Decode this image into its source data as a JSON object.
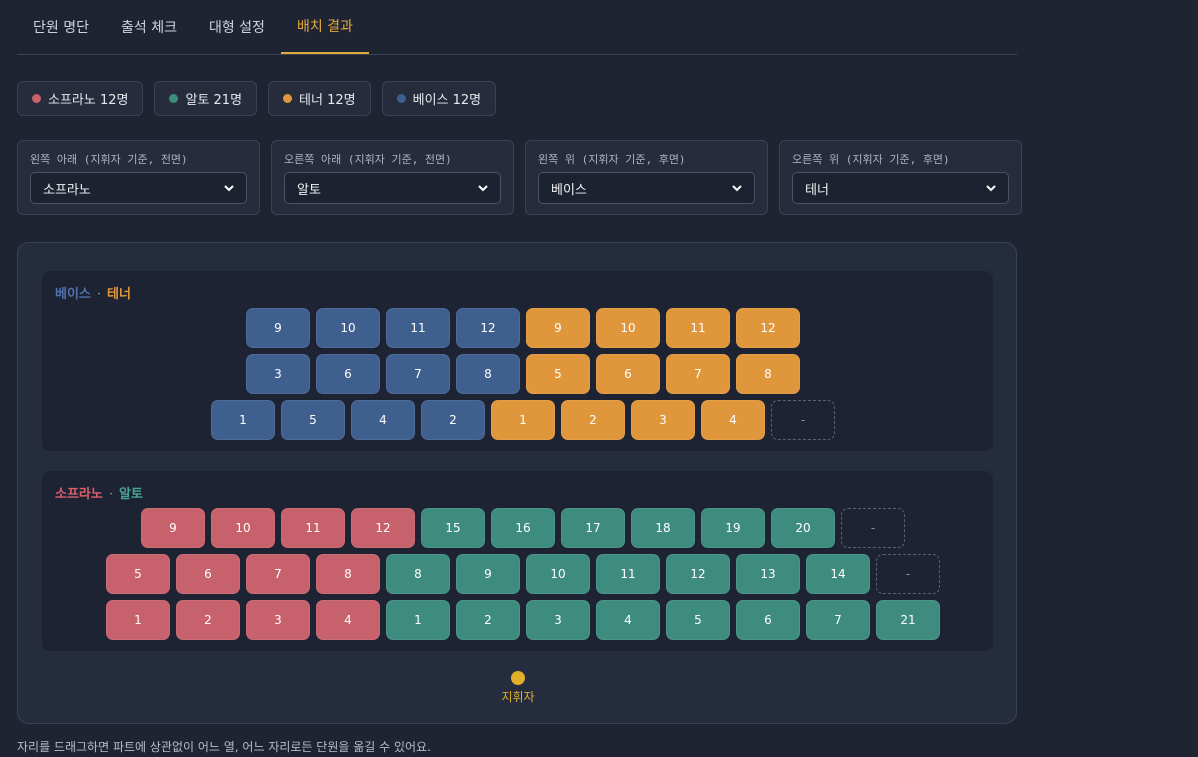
{
  "tabs": [
    {
      "label": "단원 명단"
    },
    {
      "label": "출석 체크"
    },
    {
      "label": "대형 설정"
    },
    {
      "label": "배치 결과"
    }
  ],
  "active_tab": 3,
  "parts": [
    {
      "label": "소프라노 12명",
      "color": "#c7616b"
    },
    {
      "label": "알토 21명",
      "color": "#3e8c7e"
    },
    {
      "label": "테너 12명",
      "color": "#e0963b"
    },
    {
      "label": "베이스 12명",
      "color": "#3f5f8f"
    }
  ],
  "selects": [
    {
      "label": "왼쪽 아래 (지휘자 기준, 전면)",
      "value": "소프라노"
    },
    {
      "label": "오른쪽 아래 (지휘자 기준, 전면)",
      "value": "알토"
    },
    {
      "label": "왼쪽 위 (지휘자 기준, 후면)",
      "value": "베이스"
    },
    {
      "label": "오른쪽 위 (지휘자 기준, 후면)",
      "value": "테너"
    }
  ],
  "colors": {
    "soprano": "#c7616b",
    "alto": "#3e8c7e",
    "tenor": "#e0963b",
    "bass": "#3f5f8f"
  },
  "sections": [
    {
      "left_name": "베이스",
      "right_name": "테너",
      "sep": "·",
      "left_color": "#4f73ad",
      "right_color": "#e0963b",
      "rows": [
        [
          [
            "bass",
            "9"
          ],
          [
            "bass",
            "10"
          ],
          [
            "bass",
            "11"
          ],
          [
            "bass",
            "12"
          ],
          [
            "tenor",
            "9"
          ],
          [
            "tenor",
            "10"
          ],
          [
            "tenor",
            "11"
          ],
          [
            "tenor",
            "12"
          ]
        ],
        [
          [
            "bass",
            "3"
          ],
          [
            "bass",
            "6"
          ],
          [
            "bass",
            "7"
          ],
          [
            "bass",
            "8"
          ],
          [
            "tenor",
            "5"
          ],
          [
            "tenor",
            "6"
          ],
          [
            "tenor",
            "7"
          ],
          [
            "tenor",
            "8"
          ]
        ],
        [
          [
            "bass",
            "1"
          ],
          [
            "bass",
            "5"
          ],
          [
            "bass",
            "4"
          ],
          [
            "bass",
            "2"
          ],
          [
            "tenor",
            "1"
          ],
          [
            "tenor",
            "2"
          ],
          [
            "tenor",
            "3"
          ],
          [
            "tenor",
            "4"
          ],
          [
            "empty",
            "-"
          ]
        ]
      ]
    },
    {
      "left_name": "소프라노",
      "right_name": "알토",
      "sep": "·",
      "left_color": "#d9616b",
      "right_color": "#4aa493",
      "rows": [
        [
          [
            "soprano",
            "9"
          ],
          [
            "soprano",
            "10"
          ],
          [
            "soprano",
            "11"
          ],
          [
            "soprano",
            "12"
          ],
          [
            "alto",
            "15"
          ],
          [
            "alto",
            "16"
          ],
          [
            "alto",
            "17"
          ],
          [
            "alto",
            "18"
          ],
          [
            "alto",
            "19"
          ],
          [
            "alto",
            "20"
          ],
          [
            "empty",
            "-"
          ]
        ],
        [
          [
            "soprano",
            "5"
          ],
          [
            "soprano",
            "6"
          ],
          [
            "soprano",
            "7"
          ],
          [
            "soprano",
            "8"
          ],
          [
            "alto",
            "8"
          ],
          [
            "alto",
            "9"
          ],
          [
            "alto",
            "10"
          ],
          [
            "alto",
            "11"
          ],
          [
            "alto",
            "12"
          ],
          [
            "alto",
            "13"
          ],
          [
            "alto",
            "14"
          ],
          [
            "empty",
            "-"
          ]
        ],
        [
          [
            "soprano",
            "1"
          ],
          [
            "soprano",
            "2"
          ],
          [
            "soprano",
            "3"
          ],
          [
            "soprano",
            "4"
          ],
          [
            "alto",
            "1"
          ],
          [
            "alto",
            "2"
          ],
          [
            "alto",
            "3"
          ],
          [
            "alto",
            "4"
          ],
          [
            "alto",
            "5"
          ],
          [
            "alto",
            "6"
          ],
          [
            "alto",
            "7"
          ],
          [
            "alto",
            "21"
          ]
        ]
      ]
    }
  ],
  "conductor_label": "지휘자",
  "footer": "자리를 드래그하면 파트에 상관없이 어느 열, 어느 자리로든 단원을 옮길 수 있어요."
}
